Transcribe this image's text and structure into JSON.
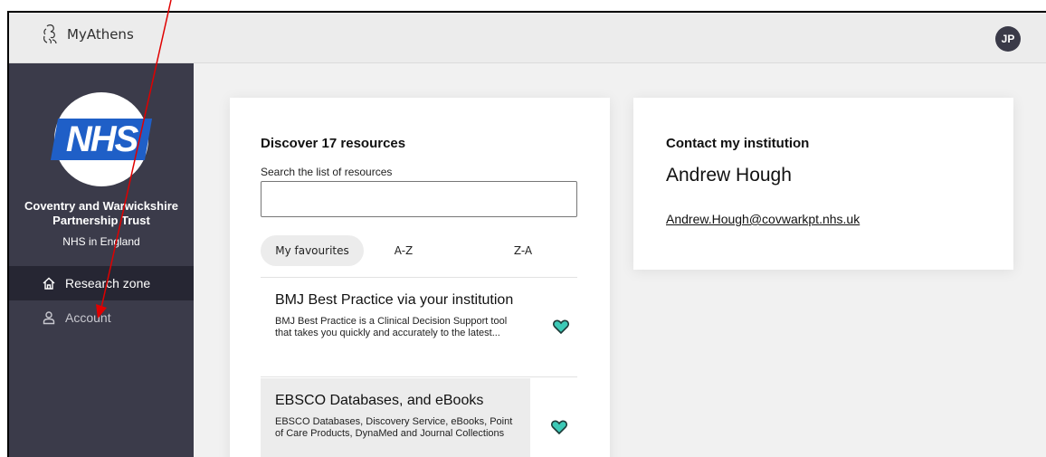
{
  "header": {
    "app_name": "MyAthens",
    "avatar_initials": "JP"
  },
  "sidebar": {
    "logo_text": "NHS",
    "org_name": "Coventry and Warwickshire Partnership Trust",
    "org_sub": "NHS in England",
    "nav": [
      {
        "label": "Research zone",
        "icon": "home-icon",
        "active": true
      },
      {
        "label": "Account",
        "icon": "user-icon",
        "active": false
      }
    ]
  },
  "discover": {
    "title": "Discover 17 resources",
    "search_label": "Search the list of resources",
    "search_value": "",
    "tabs": [
      "My favourites",
      "A-Z",
      "Z-A"
    ],
    "resources": [
      {
        "title": "BMJ Best Practice via your institution",
        "description": "BMJ Best Practice is a Clinical Decision Support tool that takes you quickly and accurately to the latest...",
        "favourite_icon": "heart-icon"
      },
      {
        "title": "EBSCO Databases, and eBooks",
        "description": "EBSCO Databases, Discovery Service, eBooks, Point of Care Products, DynaMed and Journal Collections",
        "favourite_icon": "heart-icon"
      }
    ]
  },
  "contact": {
    "title": "Contact my institution",
    "name": "Andrew Hough",
    "email": "Andrew.Hough@covwarkpt.nhs.uk"
  },
  "colors": {
    "sidebar_bg": "#3b3b4a",
    "nav_active_bg": "#262633",
    "nhs_blue": "#1f5fc7",
    "heart_fill": "#3cc9b6",
    "annotation_arrow": "#e00000"
  }
}
